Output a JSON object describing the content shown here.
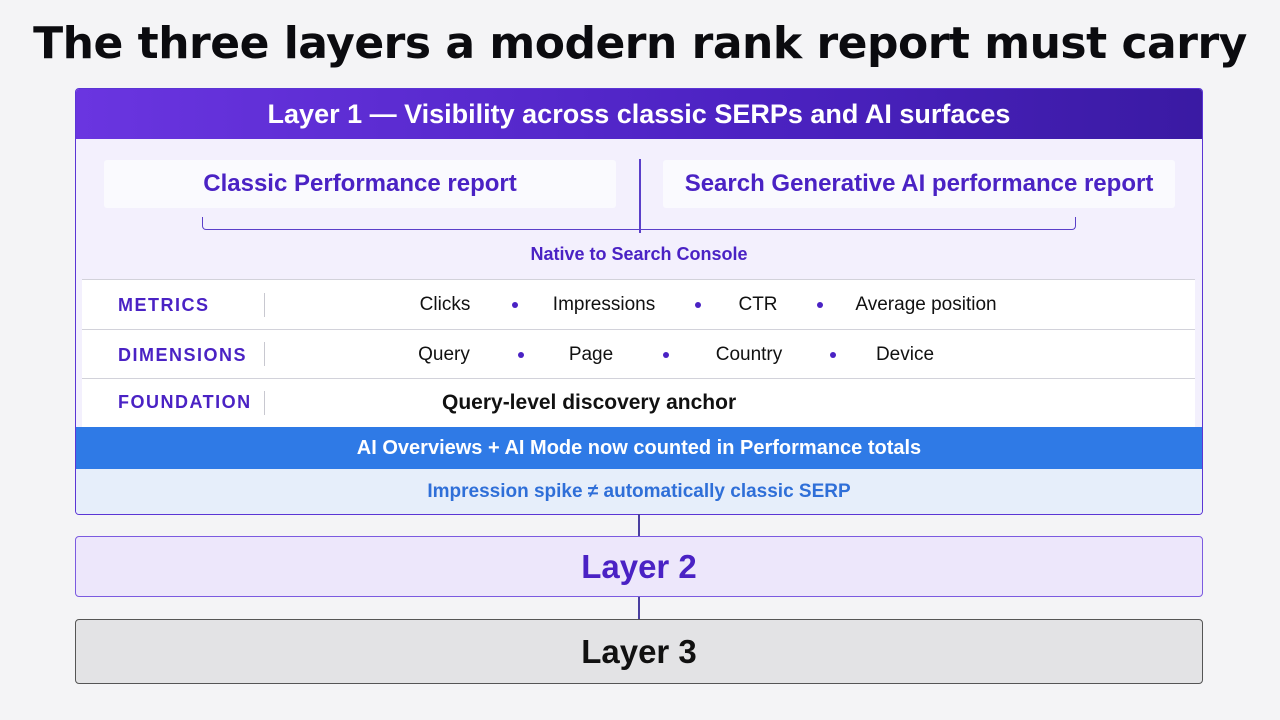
{
  "title": "The three layers a modern rank report must carry",
  "layer1": {
    "header": "Layer 1 — Visibility across classic SERPs and AI surfaces",
    "sources": {
      "left": "Classic Performance report",
      "right": "Search Generative AI performance report",
      "bracket_label": "Native to Search Console"
    },
    "rows": {
      "metrics": {
        "label": "METRICS",
        "items": [
          "Clicks",
          "Impressions",
          "CTR",
          "Average position"
        ]
      },
      "dimensions": {
        "label": "DIMENSIONS",
        "items": [
          "Query",
          "Page",
          "Country",
          "Device"
        ]
      },
      "foundation": {
        "label": "FOUNDATION",
        "value": "Query-level discovery anchor"
      }
    },
    "ai_bar": "AI Overviews + AI Mode now counted in Performance totals",
    "spike_note": "Impression spike ≠ automatically classic SERP"
  },
  "layer2": {
    "label": "Layer 2"
  },
  "layer3": {
    "label": "Layer 3"
  },
  "colors": {
    "accent_purple": "#4a22c4",
    "header_gradient_start": "#6a35e0",
    "header_gradient_end": "#3a1aa3",
    "ai_bar_blue": "#2f7ae6",
    "spike_bg": "#e6eefa",
    "layer2_bg": "#ede7fb",
    "layer3_bg": "#e3e3e5"
  }
}
